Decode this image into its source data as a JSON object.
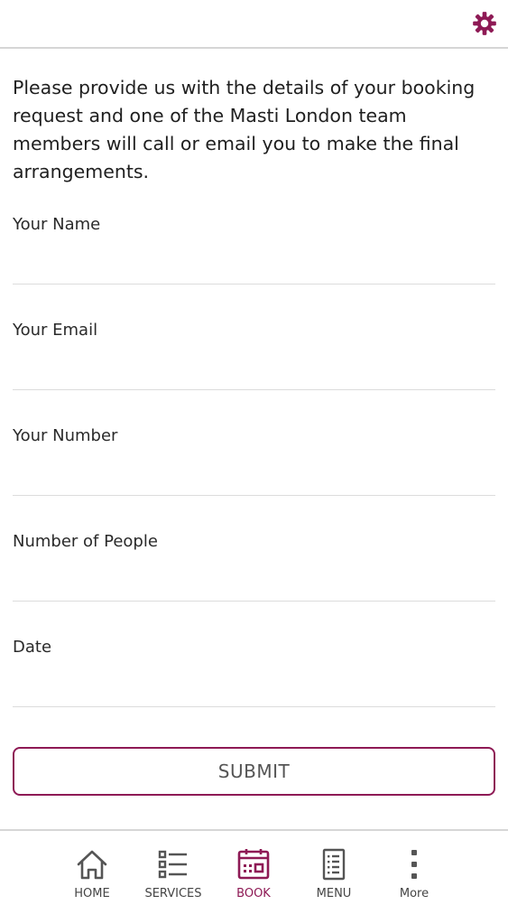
{
  "colors": {
    "accent": "#8e1a55",
    "icon": "#555555",
    "divider": "#d6d6d6"
  },
  "header": {
    "settings_icon": "gear-icon"
  },
  "intro": {
    "text": "Please provide us with the details of your booking request and one of the Masti London team members will call or email you to make the final arrangements."
  },
  "form": {
    "fields": [
      {
        "label": "Your Name",
        "value": "",
        "placeholder": ""
      },
      {
        "label": "Your Email",
        "value": "",
        "placeholder": ""
      },
      {
        "label": "Your Number",
        "value": "",
        "placeholder": ""
      },
      {
        "label": "Number of People",
        "value": "",
        "placeholder": ""
      },
      {
        "label": "Date",
        "value": "",
        "placeholder": ""
      }
    ],
    "submit_label": "SUBMIT"
  },
  "bottom_nav": {
    "items": [
      {
        "label": "HOME",
        "icon": "home-icon",
        "active": false
      },
      {
        "label": "SERVICES",
        "icon": "list-icon",
        "active": false
      },
      {
        "label": "BOOK",
        "icon": "calendar-icon",
        "active": true
      },
      {
        "label": "MENU",
        "icon": "document-icon",
        "active": false
      },
      {
        "label": "More",
        "icon": "more-vertical-icon",
        "active": false
      }
    ]
  }
}
